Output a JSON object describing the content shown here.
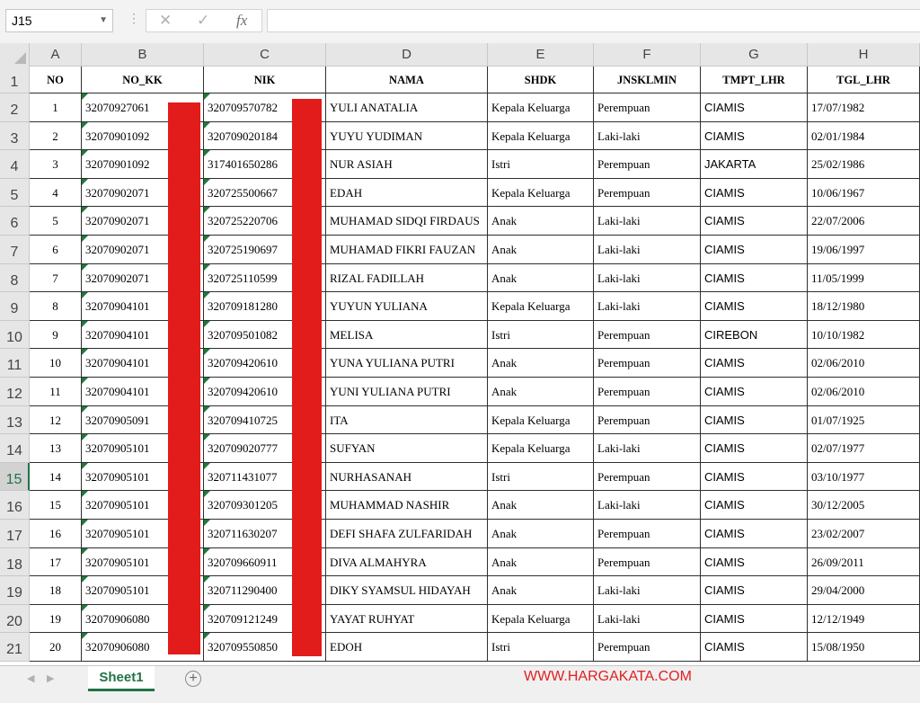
{
  "formula_bar": {
    "name_box": "J15",
    "cancel_icon": "✕",
    "enter_icon": "✓",
    "fx_label": "fx",
    "formula": ""
  },
  "columns": [
    "A",
    "B",
    "C",
    "D",
    "E",
    "F",
    "G",
    "H"
  ],
  "row_numbers": [
    "1",
    "2",
    "3",
    "4",
    "5",
    "6",
    "7",
    "8",
    "9",
    "10",
    "11",
    "12",
    "13",
    "14",
    "15",
    "16",
    "17",
    "18",
    "19",
    "20",
    "21"
  ],
  "selected_row": "15",
  "table": {
    "headers": [
      "NO",
      "NO_KK",
      "NIK",
      "NAMA",
      "SHDK",
      "JNSKLMIN",
      "TMPT_LHR",
      "TGL_LHR"
    ],
    "rows": [
      [
        "1",
        "32070927061",
        "320709570782",
        "YULI ANATALIA",
        "Kepala Keluarga",
        "Perempuan",
        "CIAMIS",
        "17/07/1982"
      ],
      [
        "2",
        "32070901092",
        "320709020184",
        "YUYU YUDIMAN",
        "Kepala Keluarga",
        "Laki-laki",
        "CIAMIS",
        "02/01/1984"
      ],
      [
        "3",
        "32070901092",
        "317401650286",
        "NUR ASIAH",
        "Istri",
        "Perempuan",
        "JAKARTA",
        "25/02/1986"
      ],
      [
        "4",
        "32070902071",
        "320725500667",
        "EDAH",
        "Kepala Keluarga",
        "Perempuan",
        "CIAMIS",
        "10/06/1967"
      ],
      [
        "5",
        "32070902071",
        "320725220706",
        "MUHAMAD SIDQI FIRDAUS",
        "Anak",
        "Laki-laki",
        "CIAMIS",
        "22/07/2006"
      ],
      [
        "6",
        "32070902071",
        "320725190697",
        "MUHAMAD FIKRI FAUZAN",
        "Anak",
        "Laki-laki",
        "CIAMIS",
        "19/06/1997"
      ],
      [
        "7",
        "32070902071",
        "320725110599",
        "RIZAL FADILLAH",
        "Anak",
        "Laki-laki",
        "CIAMIS",
        "11/05/1999"
      ],
      [
        "8",
        "32070904101",
        "320709181280",
        "YUYUN YULIANA",
        "Kepala Keluarga",
        "Laki-laki",
        "CIAMIS",
        "18/12/1980"
      ],
      [
        "9",
        "32070904101",
        "320709501082",
        "MELISA",
        "Istri",
        "Perempuan",
        "CIREBON",
        "10/10/1982"
      ],
      [
        "10",
        "32070904101",
        "320709420610",
        "YUNA YULIANA PUTRI",
        "Anak",
        "Perempuan",
        "CIAMIS",
        "02/06/2010"
      ],
      [
        "11",
        "32070904101",
        "320709420610",
        "YUNI YULIANA PUTRI",
        "Anak",
        "Perempuan",
        "CIAMIS",
        "02/06/2010"
      ],
      [
        "12",
        "32070905091",
        "320709410725",
        "ITA",
        "Kepala Keluarga",
        "Perempuan",
        "CIAMIS",
        "01/07/1925"
      ],
      [
        "13",
        "32070905101",
        "320709020777",
        "SUFYAN",
        "Kepala Keluarga",
        "Laki-laki",
        "CIAMIS",
        "02/07/1977"
      ],
      [
        "14",
        "32070905101",
        "320711431077",
        "NURHASANAH",
        "Istri",
        "Perempuan",
        "CIAMIS",
        "03/10/1977"
      ],
      [
        "15",
        "32070905101",
        "320709301205",
        "MUHAMMAD NASHIR",
        "Anak",
        "Laki-laki",
        "CIAMIS",
        "30/12/2005"
      ],
      [
        "16",
        "32070905101",
        "320711630207",
        "DEFI SHAFA ZULFARIDAH",
        "Anak",
        "Perempuan",
        "CIAMIS",
        "23/02/2007"
      ],
      [
        "17",
        "32070905101",
        "320709660911",
        "DIVA ALMAHYRA",
        "Anak",
        "Perempuan",
        "CIAMIS",
        "26/09/2011"
      ],
      [
        "18",
        "32070905101",
        "320711290400",
        "DIKY SYAMSUL HIDAYAH",
        "Anak",
        "Laki-laki",
        "CIAMIS",
        "29/04/2000"
      ],
      [
        "19",
        "32070906080",
        "320709121249",
        "YAYAT RUHYAT",
        "Kepala Keluarga",
        "Laki-laki",
        "CIAMIS",
        "12/12/1949"
      ],
      [
        "20",
        "32070906080",
        "320709550850",
        "EDOH",
        "Istri",
        "Perempuan",
        "CIAMIS",
        "15/08/1950"
      ]
    ]
  },
  "sheet_tabs": {
    "active": "Sheet1",
    "add_icon": "+"
  },
  "watermark": "WWW.HARGAKATA.COM",
  "colors": {
    "excel_green": "#217346",
    "redaction": "#e21b1b",
    "watermark": "#e02020"
  }
}
